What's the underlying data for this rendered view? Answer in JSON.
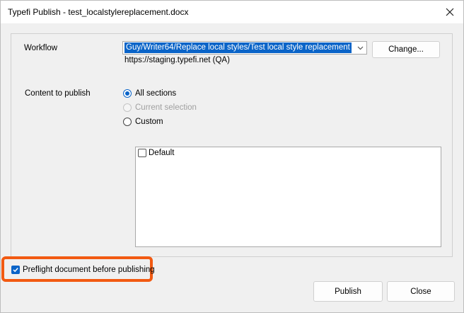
{
  "window": {
    "title": "Typefi Publish - test_localstylereplacement.docx"
  },
  "workflow": {
    "label": "Workflow",
    "value": "Guy/Writer64/Replace local styles/Test local style replacement",
    "server": "https://staging.typefi.net (QA)",
    "change_label": "Change..."
  },
  "content": {
    "label": "Content to publish",
    "options": [
      {
        "label": "All sections",
        "state": "selected"
      },
      {
        "label": "Current selection",
        "state": "disabled"
      },
      {
        "label": "Custom",
        "state": "unselected"
      }
    ],
    "list_items": [
      {
        "label": "Default",
        "checked": false
      }
    ]
  },
  "preflight": {
    "label": "Preflight document before publishing",
    "checked": true,
    "highlight_color": "#f25a12"
  },
  "actions": {
    "publish_label": "Publish",
    "close_label": "Close"
  },
  "colors": {
    "accent": "#0a64c8"
  }
}
